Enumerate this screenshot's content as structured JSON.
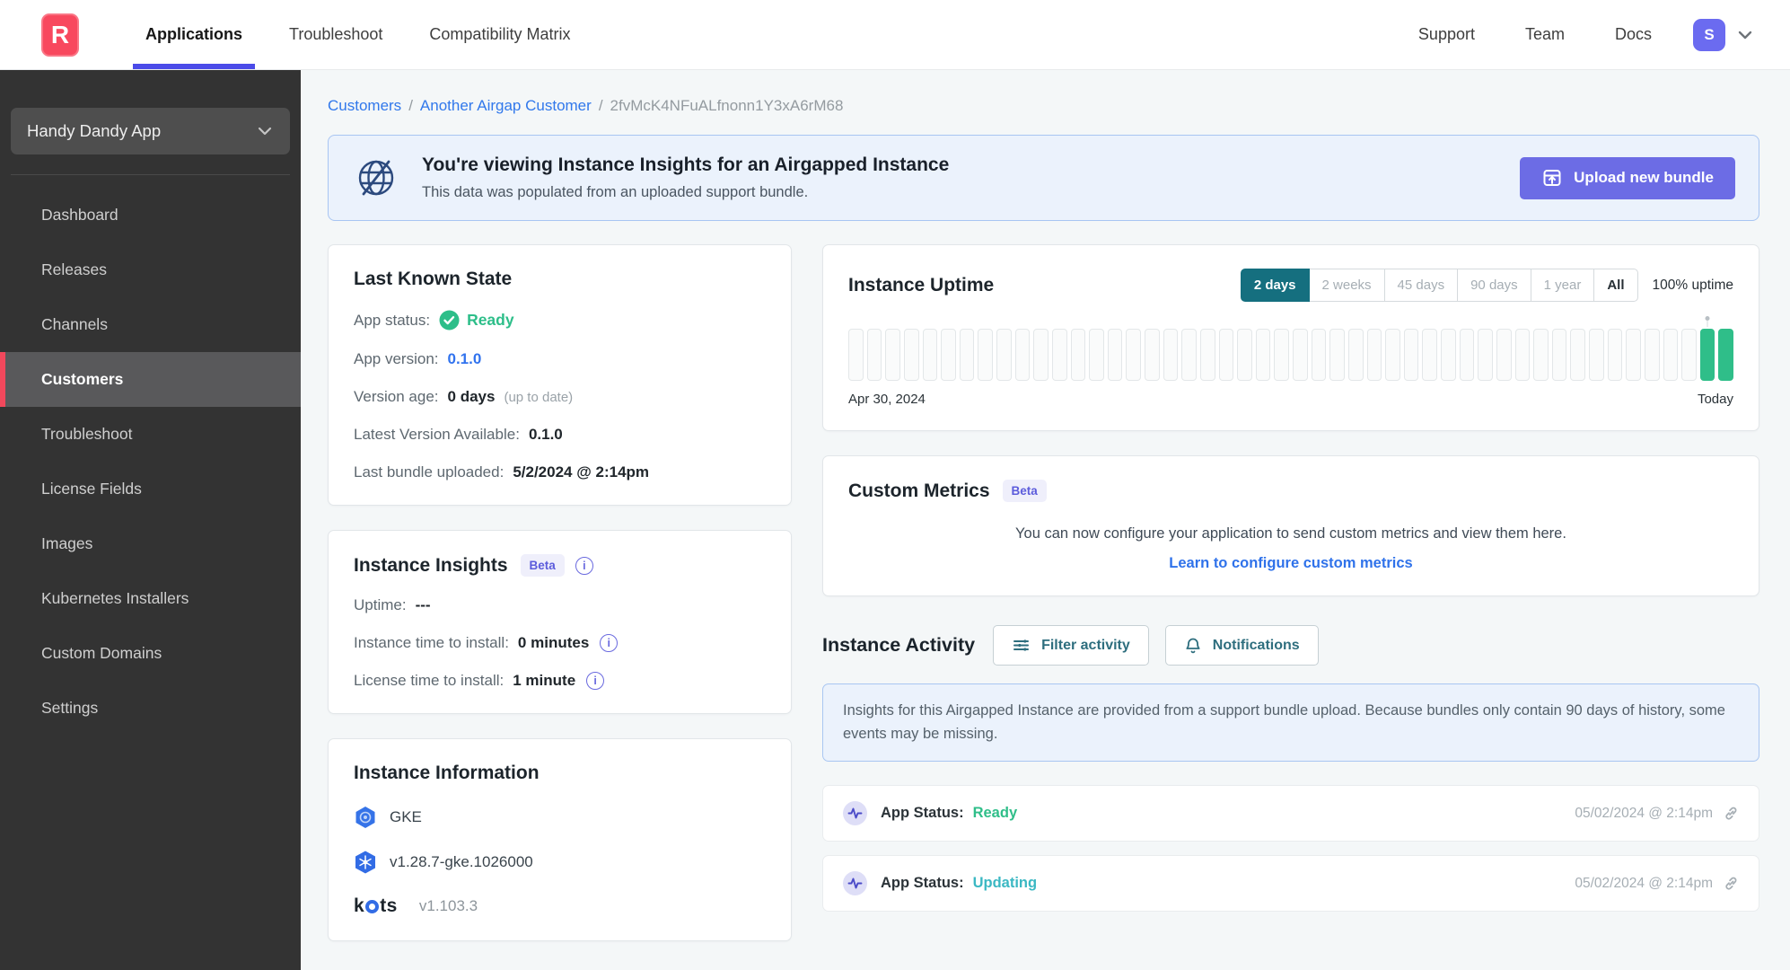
{
  "brand": {
    "logo_letter": "R",
    "accent_color": "#F8485E"
  },
  "topnav": {
    "items": [
      {
        "label": "Applications",
        "active": true
      },
      {
        "label": "Troubleshoot",
        "active": false
      },
      {
        "label": "Compatibility Matrix",
        "active": false
      }
    ],
    "right_items": [
      {
        "label": "Support"
      },
      {
        "label": "Team"
      },
      {
        "label": "Docs"
      }
    ],
    "avatar_initial": "S"
  },
  "sidebar": {
    "app_selector": "Handy Dandy App",
    "items": [
      {
        "label": "Dashboard",
        "active": false
      },
      {
        "label": "Releases",
        "active": false
      },
      {
        "label": "Channels",
        "active": false
      },
      {
        "label": "Customers",
        "active": true
      },
      {
        "label": "Troubleshoot",
        "active": false
      },
      {
        "label": "License Fields",
        "active": false
      },
      {
        "label": "Images",
        "active": false
      },
      {
        "label": "Kubernetes Installers",
        "active": false
      },
      {
        "label": "Custom Domains",
        "active": false
      },
      {
        "label": "Settings",
        "active": false
      }
    ]
  },
  "breadcrumb": {
    "segments": [
      {
        "label": "Customers"
      },
      {
        "label": "Another Airgap Customer"
      },
      {
        "label": "2fvMcK4NFuALfnonn1Y3xA6rM68"
      }
    ],
    "separator": "/"
  },
  "banner": {
    "title": "You're viewing Instance Insights for an Airgapped Instance",
    "subtitle": "This data was populated from an uploaded support bundle.",
    "button_label": "Upload new bundle"
  },
  "last_known_state": {
    "title": "Last Known State",
    "rows": {
      "app_status": {
        "label": "App status:",
        "value": "Ready"
      },
      "app_version": {
        "label": "App version:",
        "value": "0.1.0"
      },
      "version_age": {
        "label": "Version age:",
        "value": "0 days",
        "suffix": "(up to date)"
      },
      "latest_version": {
        "label": "Latest Version Available:",
        "value": "0.1.0"
      },
      "last_bundle": {
        "label": "Last bundle uploaded:",
        "value": "5/2/2024 @ 2:14pm"
      }
    }
  },
  "instance_insights": {
    "title": "Instance Insights",
    "badge": "Beta",
    "rows": {
      "uptime": {
        "label": "Uptime:",
        "value": "---"
      },
      "instance_ttn": {
        "label": "Instance time to install:",
        "value": "0 minutes"
      },
      "license_ttn": {
        "label": "License time to install:",
        "value": "1 minute"
      }
    }
  },
  "instance_information": {
    "title": "Instance Information",
    "distribution": "GKE",
    "k8s_version": "v1.28.7-gke.1026000",
    "kots_label": "k ts",
    "kots_version": "v1.103.3"
  },
  "instance_uptime": {
    "title": "Instance Uptime",
    "ranges": [
      {
        "label": "2 days",
        "active": true
      },
      {
        "label": "2 weeks",
        "active": false
      },
      {
        "label": "45 days",
        "active": false
      },
      {
        "label": "90 days",
        "active": false
      },
      {
        "label": "1 year",
        "active": false
      },
      {
        "label": "All",
        "active": false
      }
    ],
    "uptime_summary": "100% uptime"
  },
  "chart_data": {
    "type": "bar",
    "title": "Instance Uptime",
    "x_start_label": "Apr 30, 2024",
    "x_end_label": "Today",
    "selected_range": "2 days",
    "uptime_summary": "100% uptime",
    "legend": "0 = no data (empty outlined slot), 1 = up (green)",
    "values": [
      0,
      0,
      0,
      0,
      0,
      0,
      0,
      0,
      0,
      0,
      0,
      0,
      0,
      0,
      0,
      0,
      0,
      0,
      0,
      0,
      0,
      0,
      0,
      0,
      0,
      0,
      0,
      0,
      0,
      0,
      0,
      0,
      0,
      0,
      0,
      0,
      0,
      0,
      0,
      0,
      0,
      0,
      0,
      0,
      0,
      0,
      1,
      1
    ],
    "up_color": "#2FBE89"
  },
  "custom_metrics": {
    "title": "Custom Metrics",
    "badge": "Beta",
    "description": "You can now configure your application to send custom metrics and view them here.",
    "link_label": "Learn to configure custom metrics"
  },
  "instance_activity": {
    "title": "Instance Activity",
    "filter_button": "Filter activity",
    "notifications_button": "Notifications",
    "notice": "Insights for this Airgapped Instance are provided from a support bundle upload. Because bundles only contain 90 days of history, some events may be missing.",
    "events": [
      {
        "label": "App Status:",
        "status": "Ready",
        "status_color": "#2FBE89",
        "timestamp": "05/02/2024 @ 2:14pm"
      },
      {
        "label": "App Status:",
        "status": "Updating",
        "status_color": "#3BB8C3",
        "timestamp": "05/02/2024 @ 2:14pm"
      }
    ]
  }
}
